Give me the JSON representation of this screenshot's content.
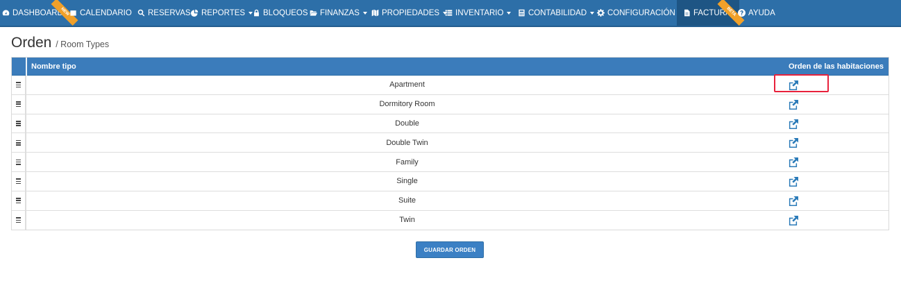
{
  "nav": {
    "items": [
      {
        "label": "DASHBOARD",
        "icon": "dashboard-icon"
      },
      {
        "label": "CALENDARIO",
        "icon": "calendar-icon"
      },
      {
        "label": "RESERVAS",
        "icon": "search-icon"
      },
      {
        "label": "REPORTES",
        "icon": "pie-chart-icon",
        "dropdown": true
      },
      {
        "label": "BLOQUEOS",
        "icon": "lock-icon"
      },
      {
        "label": "FINANZAS",
        "icon": "folder-open-icon",
        "dropdown": true
      },
      {
        "label": "PROPIEDADES",
        "icon": "map-icon",
        "dropdown": true
      },
      {
        "label": "INVENTARIO",
        "icon": "list-icon",
        "dropdown": true
      },
      {
        "label": "CONTABILIDAD",
        "icon": "calculator-icon",
        "dropdown": true
      },
      {
        "label": "CONFIGURACIÓN",
        "icon": "gear-icon",
        "dropdown": true
      },
      {
        "label": "FACTURA",
        "icon": "file-icon",
        "active": true
      },
      {
        "label": "AYUDA",
        "icon": "question-circle-icon"
      }
    ],
    "ribbons": {
      "new": "NEW",
      "beta": "BETA"
    }
  },
  "page": {
    "title": "Orden",
    "subtitle": "/ Room Types"
  },
  "table": {
    "headers": {
      "name": "Nombre tipo",
      "order": "Orden de las habitaciones"
    },
    "rows": [
      {
        "name": "Apartment"
      },
      {
        "name": "Dormitory Room"
      },
      {
        "name": "Double"
      },
      {
        "name": "Double Twin"
      },
      {
        "name": "Family"
      },
      {
        "name": "Single"
      },
      {
        "name": "Suite"
      },
      {
        "name": "Twin"
      }
    ]
  },
  "actions": {
    "save_label": "GUARDAR ORDEN"
  },
  "colors": {
    "navbar": "#2d6fa8",
    "header": "#3b7cbb",
    "link": "#2a7ab8",
    "highlight": "#e8213b",
    "ribbon": "#f0a029"
  }
}
